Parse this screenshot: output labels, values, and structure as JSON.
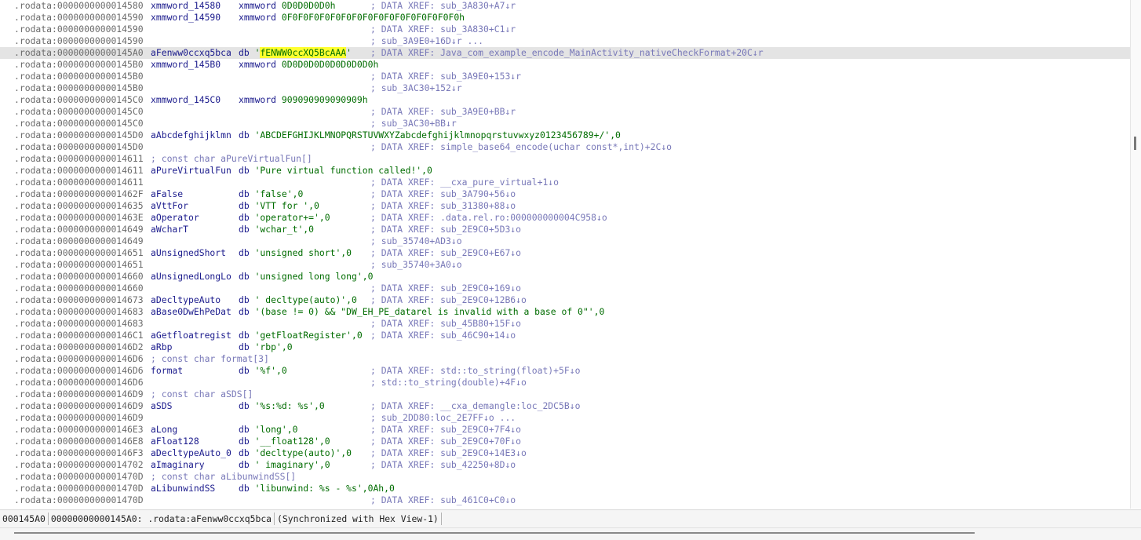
{
  "lines": [
    {
      "addr": ".rodata:0000000000014580",
      "name": "xmmword_14580",
      "dir": "xmmword",
      "val": "0D0D0D0D0h",
      "comment": "; DATA XREF: sub_3A830+A7↓r"
    },
    {
      "addr": ".rodata:0000000000014590",
      "name": "xmmword_14590",
      "dir": "xmmword",
      "val": "0F0F0F0F0F0F0F0F0F0F0F0F0F0F0F0F0h",
      "comment": ""
    },
    {
      "addr": ".rodata:0000000000014590",
      "name": "",
      "dir": "",
      "val": "",
      "comment": "; DATA XREF: sub_3A830+C1↓r"
    },
    {
      "addr": ".rodata:0000000000014590",
      "name": "",
      "dir": "",
      "val": "",
      "comment": "; sub_3A9E0+16D↓r ..."
    },
    {
      "addr": ".rodata:00000000000145A0",
      "name": "aFenww0ccxq5bca",
      "dir": "db",
      "val": "'",
      "hl": "fENWW0ccXQ5BcAAA",
      "val2": "'",
      "comment": "; DATA XREF: Java_com_example_encode_MainActivity_nativeCheckFormat+20C↓r",
      "current": true
    },
    {
      "addr": ".rodata:00000000000145B0",
      "name": "xmmword_145B0",
      "dir": "xmmword",
      "val": "0D0D0D0D0D0D0D0D0h",
      "comment": ""
    },
    {
      "addr": ".rodata:00000000000145B0",
      "name": "",
      "dir": "",
      "val": "",
      "comment": "; DATA XREF: sub_3A9E0+153↓r"
    },
    {
      "addr": ".rodata:00000000000145B0",
      "name": "",
      "dir": "",
      "val": "",
      "comment": "; sub_3AC30+152↓r"
    },
    {
      "addr": ".rodata:00000000000145C0",
      "name": "xmmword_145C0",
      "dir": "xmmword",
      "val": "909090909090909h",
      "comment": ""
    },
    {
      "addr": ".rodata:00000000000145C0",
      "name": "",
      "dir": "",
      "val": "",
      "comment": "; DATA XREF: sub_3A9E0+BB↓r"
    },
    {
      "addr": ".rodata:00000000000145C0",
      "name": "",
      "dir": "",
      "val": "",
      "comment": "; sub_3AC30+BB↓r"
    },
    {
      "addr": ".rodata:00000000000145D0",
      "name": "aAbcdefghijklmn",
      "dir": "db",
      "val": "'ABCDEFGHIJKLMNOPQRSTUVWXYZabcdefghijklmnopqrstuvwxyz0123456789+/',0",
      "comment": ""
    },
    {
      "addr": ".rodata:00000000000145D0",
      "name": "",
      "dir": "",
      "val": "",
      "comment": "; DATA XREF: simple_base64_encode(uchar const*,int)+2C↓o"
    },
    {
      "addr": ".rodata:0000000000014611",
      "full": "; const char aPureVirtualFun[]"
    },
    {
      "addr": ".rodata:0000000000014611",
      "name": "aPureVirtualFun",
      "dir": "db",
      "val": "'Pure virtual function called!',0",
      "comment": ""
    },
    {
      "addr": ".rodata:0000000000014611",
      "name": "",
      "dir": "",
      "val": "",
      "comment": "; DATA XREF: __cxa_pure_virtual+1↓o"
    },
    {
      "addr": ".rodata:000000000001462F",
      "name": "aFalse",
      "dir": "db",
      "val": "'false',0",
      "comment": "; DATA XREF: sub_3A790+56↓o"
    },
    {
      "addr": ".rodata:0000000000014635",
      "name": "aVttFor",
      "dir": "db",
      "val": "'VTT for ',0",
      "comment": "; DATA XREF: sub_31380+88↓o"
    },
    {
      "addr": ".rodata:000000000001463E",
      "name": "aOperator",
      "dir": "db",
      "val": "'operator+=',0",
      "comment": "; DATA XREF: .data.rel.ro:000000000004C958↓o"
    },
    {
      "addr": ".rodata:0000000000014649",
      "name": "aWcharT",
      "dir": "db",
      "val": "'wchar_t',0",
      "comment": "; DATA XREF: sub_2E9C0+5D3↓o"
    },
    {
      "addr": ".rodata:0000000000014649",
      "name": "",
      "dir": "",
      "val": "",
      "comment": "; sub_35740+AD3↓o"
    },
    {
      "addr": ".rodata:0000000000014651",
      "name": "aUnsignedShort",
      "dir": "db",
      "val": "'unsigned short',0",
      "comment": "; DATA XREF: sub_2E9C0+E67↓o"
    },
    {
      "addr": ".rodata:0000000000014651",
      "name": "",
      "dir": "",
      "val": "",
      "comment": "; sub_35740+3A0↓o"
    },
    {
      "addr": ".rodata:0000000000014660",
      "name": "aUnsignedLongLo",
      "dir": "db",
      "val": "'unsigned long long',0",
      "comment": ""
    },
    {
      "addr": ".rodata:0000000000014660",
      "name": "",
      "dir": "",
      "val": "",
      "comment": "; DATA XREF: sub_2E9C0+169↓o"
    },
    {
      "addr": ".rodata:0000000000014673",
      "name": "aDecltypeAuto",
      "dir": "db",
      "val": "' decltype(auto)',0",
      "comment": "; DATA XREF: sub_2E9C0+12B6↓o"
    },
    {
      "addr": ".rodata:0000000000014683",
      "name": "aBase0DwEhPeDat",
      "dir": "db",
      "val": "'(base != 0) && \"DW_EH_PE_datarel is invalid with a base of 0\"',0",
      "comment": ""
    },
    {
      "addr": ".rodata:0000000000014683",
      "name": "",
      "dir": "",
      "val": "",
      "comment": "; DATA XREF: sub_45B80+15F↓o"
    },
    {
      "addr": ".rodata:00000000000146C1",
      "name": "aGetfloatregist",
      "dir": "db",
      "val": "'getFloatRegister',0",
      "comment": "; DATA XREF: sub_46C90+14↓o"
    },
    {
      "addr": ".rodata:00000000000146D2",
      "name": "aRbp",
      "dir": "db",
      "val": "'rbp',0",
      "comment": ""
    },
    {
      "addr": ".rodata:00000000000146D6",
      "full": "; const char format[3]"
    },
    {
      "addr": ".rodata:00000000000146D6",
      "name": "format",
      "dir": "db",
      "val": "'%f',0",
      "comment": "; DATA XREF: std::to_string(float)+5F↓o"
    },
    {
      "addr": ".rodata:00000000000146D6",
      "name": "",
      "dir": "",
      "val": "",
      "comment": "; std::to_string(double)+4F↓o"
    },
    {
      "addr": ".rodata:00000000000146D9",
      "full": "; const char aSDS[]"
    },
    {
      "addr": ".rodata:00000000000146D9",
      "name": "aSDS",
      "dir": "db",
      "val": "'%s:%d: %s',0",
      "comment": "; DATA XREF: __cxa_demangle:loc_2DC5B↓o"
    },
    {
      "addr": ".rodata:00000000000146D9",
      "name": "",
      "dir": "",
      "val": "",
      "comment": "; sub_2DD80:loc_2E7FF↓o ..."
    },
    {
      "addr": ".rodata:00000000000146E3",
      "name": "aLong",
      "dir": "db",
      "val": "'long',0",
      "comment": "; DATA XREF: sub_2E9C0+7F4↓o"
    },
    {
      "addr": ".rodata:00000000000146E8",
      "name": "aFloat128",
      "dir": "db",
      "val": "'__float128',0",
      "comment": "; DATA XREF: sub_2E9C0+70F↓o"
    },
    {
      "addr": ".rodata:00000000000146F3",
      "name": "aDecltypeAuto_0",
      "dir": "db",
      "val": "'decltype(auto)',0",
      "comment": "; DATA XREF: sub_2E9C0+14E3↓o"
    },
    {
      "addr": ".rodata:0000000000014702",
      "name": "aImaginary",
      "dir": "db",
      "val": "' imaginary',0",
      "comment": "; DATA XREF: sub_42250+8D↓o"
    },
    {
      "addr": ".rodata:000000000001470D",
      "full": "; const char aLibunwindSS[]"
    },
    {
      "addr": ".rodata:000000000001470D",
      "name": "aLibunwindSS",
      "dir": "db",
      "val": "'libunwind: %s - %s',0Ah,0",
      "comment": ""
    },
    {
      "addr": ".rodata:000000000001470D",
      "name": "",
      "dir": "",
      "val": "",
      "comment": "; DATA XREF: sub_461C0+C0↓o"
    }
  ],
  "status": {
    "offset": "000145A0",
    "location": "00000000000145A0: .rodata:aFenww0ccxq5bca",
    "sync": "(Synchronized with Hex View-1)"
  }
}
